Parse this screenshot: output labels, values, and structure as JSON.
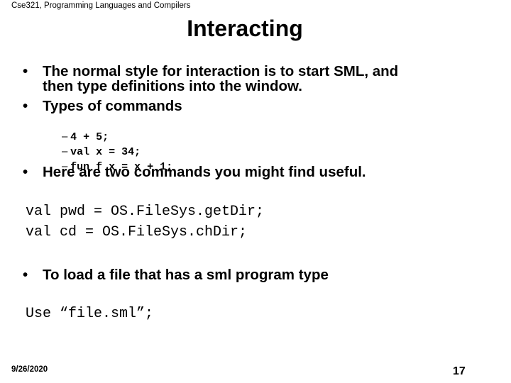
{
  "header": {
    "course": "Cse321, Programming Languages and Compilers"
  },
  "slide": {
    "title": "Interacting",
    "bullets": [
      {
        "line1": "The normal style for interaction is to start SML, and",
        "line2": "then type definitions into the window."
      },
      {
        "text": "Types of commands"
      },
      {
        "text": "Here are two commands you might find useful."
      },
      {
        "text": "To load a file that has a sml program type"
      }
    ],
    "bullet_glyph": "•",
    "sub_glyph": "–",
    "sub_items": [
      "4 + 5;",
      "val x = 34;",
      "fun f x = x + 1;"
    ],
    "code_block_1": [
      "val pwd = OS.FileSys.getDir;",
      "val cd = OS.FileSys.chDir;"
    ],
    "code_block_2": [
      "Use “file.sml”;"
    ]
  },
  "footer": {
    "date": "9/26/2020",
    "page_number": "17"
  }
}
